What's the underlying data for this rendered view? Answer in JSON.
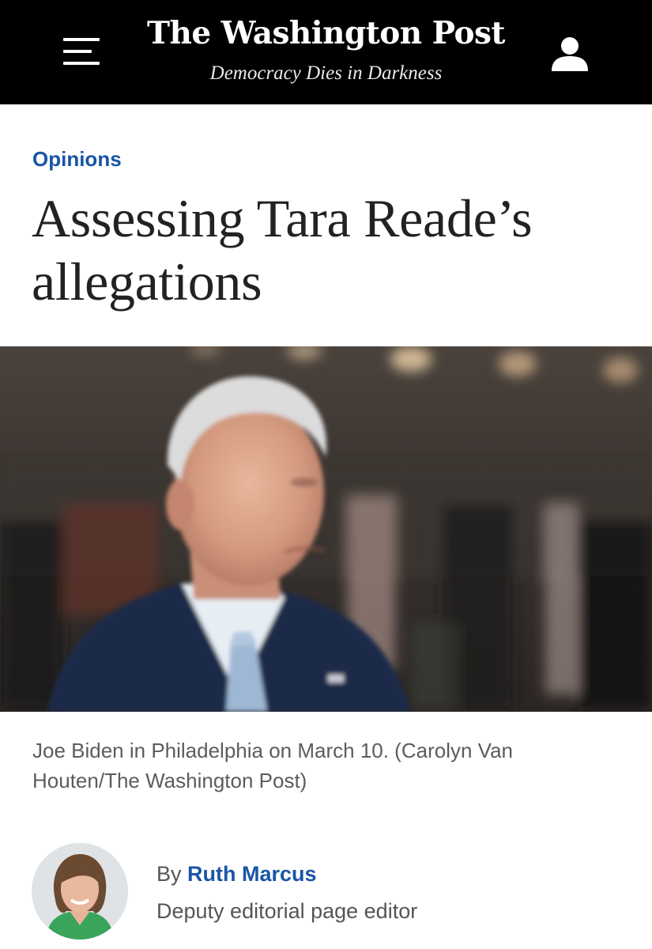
{
  "header": {
    "title": "The Washington Post",
    "tagline": "Democracy Dies in Darkness",
    "menu_icon": "hamburger-menu-icon",
    "user_icon": "user-account-icon"
  },
  "article": {
    "section": "Opinions",
    "headline": "Assessing Tara Reade’s allegations",
    "photo_caption": "Joe Biden in Philadelphia on March 10. (Carolyn Van Houten/The Washington Post)"
  },
  "byline": {
    "prefix": "By",
    "author": "Ruth Marcus",
    "author_title": "Deputy editorial page editor"
  },
  "colors": {
    "header_bg": "#000000",
    "link_blue": "#1955a5",
    "text_dark": "#222222",
    "text_gray": "#555555"
  }
}
